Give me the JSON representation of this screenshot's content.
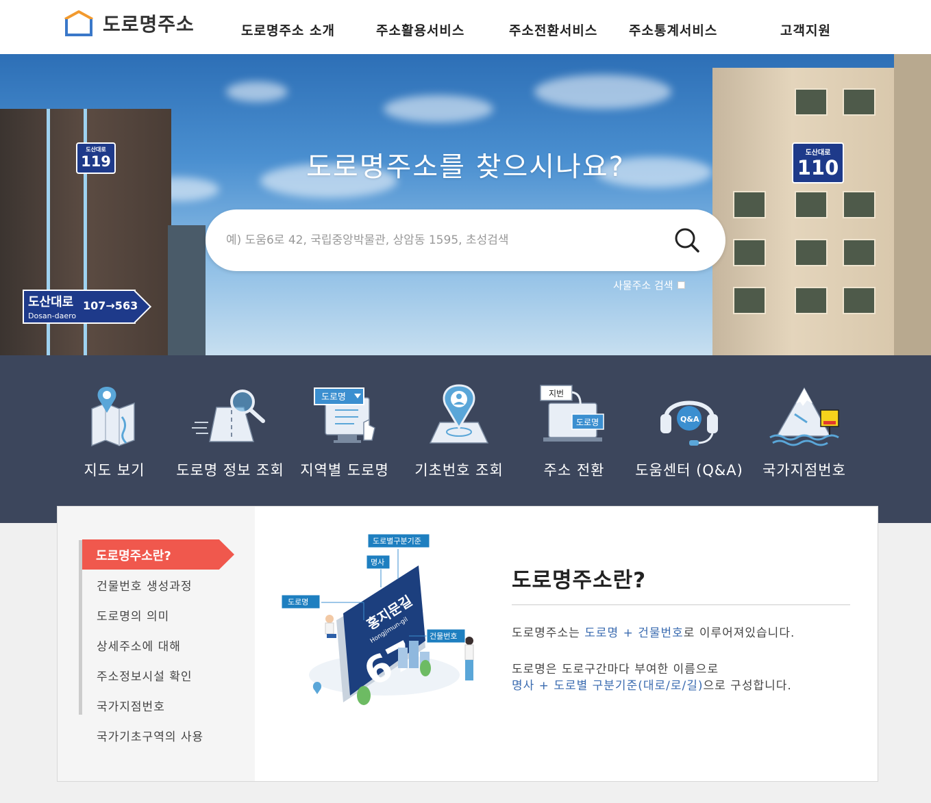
{
  "header": {
    "logo_text": "도로명주소",
    "nav": [
      "도로명주소 소개",
      "주소활용서비스",
      "주소전환서비스",
      "주소통계서비스",
      "고객지원"
    ]
  },
  "hero": {
    "title": "도로명주소를 찾으시나요?",
    "search_placeholder": "예) 도움6로 42, 국립중앙박물관, 상암동 1595, 초성검색",
    "thing_search_label": "사물주소 검색",
    "sign_left_top": "도산대로",
    "sign_left_num": "119",
    "sign_right_top": "도산대로",
    "sign_right_num": "110",
    "road_sign_name": "도산대로",
    "road_sign_roman": "Dosan-daero",
    "road_sign_range": "107→563"
  },
  "quick_menu": [
    {
      "label": "지도 보기",
      "icon": "map-icon"
    },
    {
      "label": "도로명 정보 조회",
      "icon": "road-search-icon"
    },
    {
      "label": "지역별 도로명",
      "icon": "region-road-icon"
    },
    {
      "label": "기초번호 조회",
      "icon": "location-pin-icon"
    },
    {
      "label": "주소 전환",
      "icon": "address-convert-icon"
    },
    {
      "label": "도움센터 (Q&A)",
      "icon": "headset-qa-icon"
    },
    {
      "label": "국가지점번호",
      "icon": "mountain-marker-icon"
    }
  ],
  "quick_menu_icon_text": {
    "region_select": "도로명",
    "convert_from": "지번",
    "convert_to": "도로명",
    "qa": "Q&A"
  },
  "lnb": {
    "active": "도로명주소란?",
    "items": [
      "건물번호 생성과정",
      "도로명의 의미",
      "상세주소에 대해",
      "주소정보시설 확인",
      "국가지점번호",
      "국가기초구역의 사용"
    ]
  },
  "illustration": {
    "tag_criteria": "도로별구분기준",
    "tag_title": "명사",
    "tag_road": "도로명",
    "tag_building_no": "건물번호",
    "sign_name": "홍지문길",
    "sign_roman": "Hongjimun-gil",
    "sign_number": "67"
  },
  "content": {
    "title": "도로명주소란?",
    "p1_prefix": "도로명주소는 ",
    "p1_hl": "도로명 + 건물번호",
    "p1_suffix": "로 이루어져있습니다.",
    "p2_line1": "도로명은 도로구간마다 부여한 이름으로",
    "p2_hl": "명사 + 도로별 구분기준(대로/로/길)",
    "p2_suffix": "으로 구성합니다."
  },
  "colors": {
    "accent_red": "#f0584d",
    "quick_bg": "#3c465c",
    "link_blue": "#3a6bb0",
    "sign_blue": "#1e3a8a"
  }
}
